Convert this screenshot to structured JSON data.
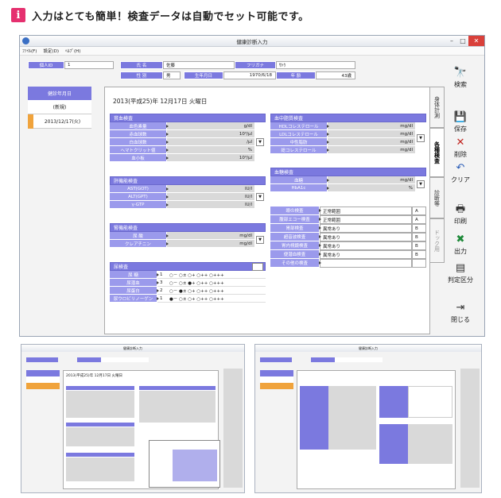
{
  "header": {
    "badge": "i",
    "text": "入力はとても簡単！検査データは自動でセット可能です。"
  },
  "window": {
    "title": "健康診断入力",
    "menu": [
      "ﾌｧｲﾙ(F)",
      "設定(D)",
      "ﾍﾙﾌﾟ(H)"
    ]
  },
  "info": {
    "id_label": "個人ID",
    "id_value": "1",
    "name_label": "氏 名",
    "name_value": "佐藤",
    "kana_label": "フリガナ",
    "kana_value": "ｻﾄｳ",
    "sex_label": "性 別",
    "sex_value": "男",
    "birth_label": "生年月日",
    "birth_value": "1970/6/18",
    "age_label": "年 齢",
    "age_value": "43歳"
  },
  "datelist": {
    "header": "健診年月日",
    "items": [
      "(新規)",
      "2013/12/17(火)"
    ]
  },
  "panel": {
    "date": "2013(平成25)年 12月17日 火曜日"
  },
  "sections": {
    "blood": {
      "title": "貧血検査",
      "rows": [
        {
          "label": "血色素量",
          "unit": "g/dl"
        },
        {
          "label": "赤血球数",
          "unit": "10⁴/μl"
        },
        {
          "label": "白血球数",
          "unit": "/μl"
        },
        {
          "label": "ヘマトクリット値",
          "unit": "%"
        },
        {
          "label": "血小板",
          "unit": "10⁴/μl"
        }
      ]
    },
    "liver": {
      "title": "肝機能検査",
      "rows": [
        {
          "label": "AST(GOT)",
          "unit": "IU/l"
        },
        {
          "label": "ALT(GPT)",
          "unit": "IU/l"
        },
        {
          "label": "γ-GTP",
          "unit": "IU/l"
        }
      ]
    },
    "kidney": {
      "title": "腎機能検査",
      "rows": [
        {
          "label": "尿 酸",
          "unit": "mg/dl"
        },
        {
          "label": "クレアチニン",
          "unit": "mg/dl"
        }
      ]
    },
    "urine": {
      "title": "尿検査",
      "rows": [
        {
          "label": "尿 糖",
          "sel": "1",
          "opts": "○－ ○± ○+ ○++ ○+++"
        },
        {
          "label": "尿潜血",
          "sel": "3",
          "opts": "○－ ○± ●+ ○++ ○+++"
        },
        {
          "label": "尿蛋白",
          "sel": "2",
          "opts": "○－ ●± ○+ ○++ ○+++"
        },
        {
          "label": "尿ウロビリノーゲン",
          "sel": "1",
          "opts": "●－ ○± ○+ ○++ ○+++"
        }
      ]
    },
    "lipid": {
      "title": "血中脂質検査",
      "rows": [
        {
          "label": "HDLコレステロール",
          "unit": "mg/dl"
        },
        {
          "label": "LDLコレステロール",
          "unit": "mg/dl"
        },
        {
          "label": "中性脂肪",
          "unit": "mg/dl"
        },
        {
          "label": "総コレステロール",
          "unit": "mg/dl"
        }
      ]
    },
    "sugar": {
      "title": "血糖検査",
      "rows": [
        {
          "label": "血糖",
          "unit": "mg/dl"
        },
        {
          "label": "HbA1c",
          "unit": "%"
        }
      ]
    },
    "exams": {
      "rows": [
        {
          "label": "眼の検査",
          "value": "正常範囲",
          "grade": "A"
        },
        {
          "label": "腹部エコー検査",
          "value": "正常範囲",
          "grade": "A"
        },
        {
          "label": "胃部検査",
          "value": "異常あり",
          "grade": "B"
        },
        {
          "label": "超音波検査",
          "value": "異常あり",
          "grade": "B"
        },
        {
          "label": "胃内視鏡検査",
          "value": "異常あり",
          "grade": "B"
        },
        {
          "label": "便潜血検査",
          "value": "異常あり",
          "grade": "B"
        },
        {
          "label": "その他の検査",
          "value": "",
          "grade": ""
        }
      ]
    }
  },
  "tabs": [
    "身体計測",
    "各種検査",
    "診断等",
    "ドック用"
  ],
  "buttons": {
    "search": "検索",
    "save": "保存",
    "delete": "削除",
    "clear": "クリア",
    "print": "印刷",
    "output": "出力",
    "judge": "判定区分",
    "close": "閉じる"
  },
  "thumb": {
    "title1": "健康診断入力",
    "title2": "健康診断入力",
    "date": "2013(平成25)年 12月17日 火曜日"
  }
}
